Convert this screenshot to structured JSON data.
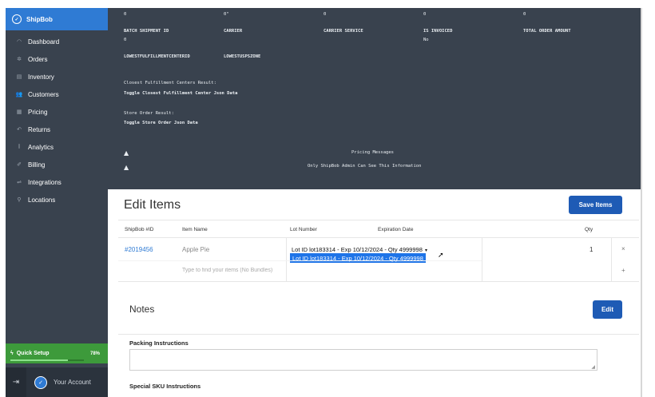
{
  "brand": {
    "name": "ShipBob"
  },
  "sidebar": {
    "items": [
      {
        "label": "Dashboard",
        "icon": "dashboard-icon"
      },
      {
        "label": "Orders",
        "icon": "orders-icon"
      },
      {
        "label": "Inventory",
        "icon": "inventory-icon"
      },
      {
        "label": "Customers",
        "icon": "customers-icon"
      },
      {
        "label": "Pricing",
        "icon": "pricing-icon"
      },
      {
        "label": "Returns",
        "icon": "returns-icon"
      },
      {
        "label": "Analytics",
        "icon": "analytics-icon"
      },
      {
        "label": "Billing",
        "icon": "billing-icon"
      },
      {
        "label": "Integrations",
        "icon": "integrations-icon"
      },
      {
        "label": "Locations",
        "icon": "locations-icon"
      }
    ],
    "quick_setup": {
      "label": "Quick Setup",
      "percent_text": "78%",
      "progress": 0.78
    },
    "account": {
      "label": "Your Account"
    }
  },
  "debug": {
    "row0": [
      "0",
      "0\"",
      "0",
      "0",
      "0"
    ],
    "headers": [
      "BATCH SHIPMENT ID",
      "CARRIER",
      "CARRIER SERVICE",
      "IS INVOICED",
      "TOTAL ORDER AMOUNT"
    ],
    "values": [
      "0",
      "No"
    ],
    "lowest_fc": "LOWESTFULFILLMENTCENTERID",
    "lowest_usps": "LOWESTUSPSZONE",
    "closest_label": "Closest Fulfillment Centers Result:",
    "closest_toggle": "Toggle Closest Fulfillment Center Json Data",
    "store_label": "Store Order Result:",
    "store_toggle": "Toggle Store Order Json Data",
    "pricing_messages": "Pricing Messages",
    "admin_note": "Only ShipBob Admin Can See This Information"
  },
  "edit_items": {
    "title": "Edit Items",
    "save_label": "Save Items",
    "columns": [
      "ShipBob #ID",
      "Item Name",
      "Lot Number",
      "Expiration Date",
      "Qty"
    ],
    "row": {
      "id": "#2019456",
      "name": "Apple Pie",
      "lot_selected": "Lot ID lot183314 - Exp 10/12/2024 - Qty 4999998",
      "lot_option": "Lot ID lot183314 - Exp 10/12/2024 - Qty 4999998",
      "qty": "1",
      "remove_symbol": "×"
    },
    "search_placeholder": "Type to find your items (No Bundles)",
    "add_symbol": "+"
  },
  "notes": {
    "title": "Notes",
    "edit_label": "Edit",
    "packing_label": "Packing Instructions",
    "special_label": "Special SKU Instructions"
  },
  "colors": {
    "sidebar": "#39424e",
    "brand": "#2f7bd4",
    "primary_button": "#1e5bb5",
    "quick_setup": "#3d9a3b"
  }
}
